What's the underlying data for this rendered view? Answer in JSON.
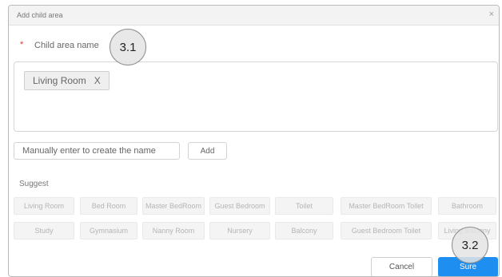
{
  "dialog": {
    "title": "Add child area",
    "close_glyph": "×",
    "required_mark": "*",
    "field_label": "Child area name",
    "tags": [
      {
        "label": "Living Room",
        "remove": "X"
      }
    ],
    "name_input_placeholder": "Manually enter to create the name",
    "add_label": "Add",
    "suggest_label": "Suggest",
    "suggestions": [
      "Living Room",
      "Bed Room",
      "Master BedRoom",
      "Guest Bedroom",
      "Toilet",
      "Master BedRoom Toilet",
      "Bathroom",
      "Study",
      "Gymnasium",
      "Nanny Room",
      "Nursery",
      "Balcony",
      "Guest Bedroom Toilet",
      "Living Balcony"
    ],
    "cancel_label": "Cancel",
    "sure_label": "Sure"
  },
  "annotations": {
    "callout_1": "3.1",
    "callout_2": "3.2"
  },
  "colors": {
    "primary": "#1e8ff0",
    "required": "#e0352b"
  }
}
